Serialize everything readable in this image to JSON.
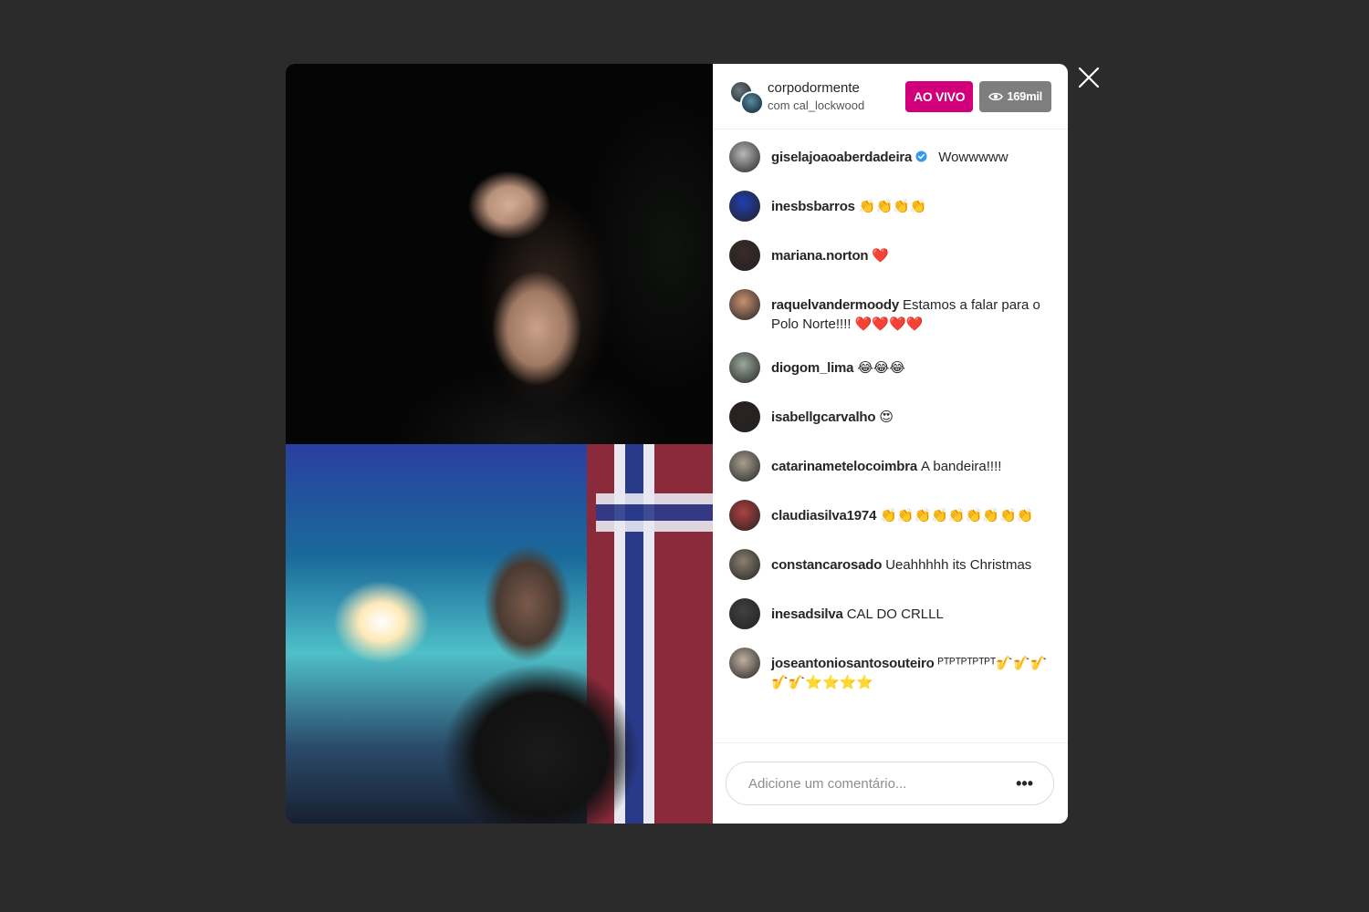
{
  "header": {
    "host_name": "corpodormente",
    "guest_text": "com cal_lockwood",
    "live_label": "AO VIVO",
    "viewers": "169mil"
  },
  "comments": [
    {
      "user": "giselajoaoaberdadeira",
      "text": "Wowwwww",
      "verified": true,
      "avatar_color": "#b9b9b9"
    },
    {
      "user": "inesbsbarros",
      "text": "👏👏👏👏",
      "verified": false,
      "avatar_color": "#1f3fb0"
    },
    {
      "user": "mariana.norton",
      "text": "❤️",
      "verified": false,
      "avatar_color": "#3a2a28"
    },
    {
      "user": "raquelvandermoody",
      "text": "Estamos a falar para o Polo Norte!!!! ❤️❤️❤️❤️",
      "verified": false,
      "avatar_color": "#c89070"
    },
    {
      "user": "diogom_lima",
      "text": "😂😂😂",
      "verified": false,
      "avatar_color": "#9aa89a"
    },
    {
      "user": "isabellgcarvalho",
      "text": "😍",
      "verified": false,
      "avatar_color": "#2a2220"
    },
    {
      "user": "catarinametelocoimbra",
      "text": "A bandeira!!!!",
      "verified": false,
      "avatar_color": "#a8a090"
    },
    {
      "user": "claudiasilva1974",
      "text": "👏👏👏👏👏👏👏👏👏",
      "verified": false,
      "avatar_color": "#b04040"
    },
    {
      "user": "constancarosado",
      "text": "Ueahhhhh its Christmas",
      "verified": false,
      "avatar_color": "#8a8070"
    },
    {
      "user": "inesadsilva",
      "text": "CAL DO CRLLL",
      "verified": false,
      "avatar_color": "#404040"
    },
    {
      "user": "joseantoniosantosouteiro",
      "text": "ᴾᵀᴾᵀᴾᵀᴾᵀᴾᵀ🎷🎷🎷🎷🎷⭐⭐⭐⭐",
      "verified": false,
      "avatar_color": "#c0b0a0"
    }
  ],
  "footer": {
    "comment_placeholder": "Adicione um comentário...",
    "more_label": "•••"
  },
  "colors": {
    "live": "#d1007a",
    "viewers_bg": "#7e7e7e",
    "backdrop": "#2b2b2b"
  },
  "icons": {
    "close": "close-icon",
    "eye": "eye-icon",
    "verified": "verified-badge-icon"
  }
}
